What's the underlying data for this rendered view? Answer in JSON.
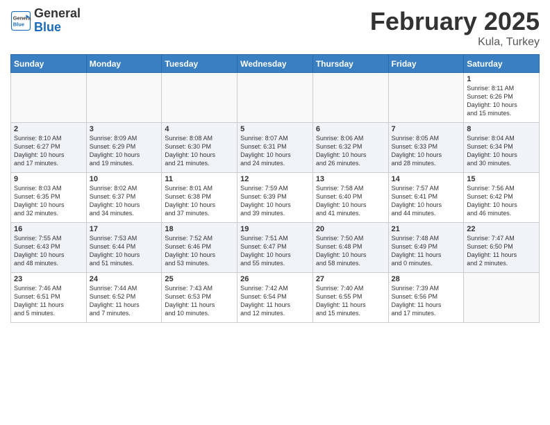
{
  "header": {
    "logo_line1": "General",
    "logo_line2": "Blue",
    "month_title": "February 2025",
    "location": "Kula, Turkey"
  },
  "weekdays": [
    "Sunday",
    "Monday",
    "Tuesday",
    "Wednesday",
    "Thursday",
    "Friday",
    "Saturday"
  ],
  "weeks": [
    [
      {
        "day": "",
        "info": ""
      },
      {
        "day": "",
        "info": ""
      },
      {
        "day": "",
        "info": ""
      },
      {
        "day": "",
        "info": ""
      },
      {
        "day": "",
        "info": ""
      },
      {
        "day": "",
        "info": ""
      },
      {
        "day": "1",
        "info": "Sunrise: 8:11 AM\nSunset: 6:26 PM\nDaylight: 10 hours\nand 15 minutes."
      }
    ],
    [
      {
        "day": "2",
        "info": "Sunrise: 8:10 AM\nSunset: 6:27 PM\nDaylight: 10 hours\nand 17 minutes."
      },
      {
        "day": "3",
        "info": "Sunrise: 8:09 AM\nSunset: 6:29 PM\nDaylight: 10 hours\nand 19 minutes."
      },
      {
        "day": "4",
        "info": "Sunrise: 8:08 AM\nSunset: 6:30 PM\nDaylight: 10 hours\nand 21 minutes."
      },
      {
        "day": "5",
        "info": "Sunrise: 8:07 AM\nSunset: 6:31 PM\nDaylight: 10 hours\nand 24 minutes."
      },
      {
        "day": "6",
        "info": "Sunrise: 8:06 AM\nSunset: 6:32 PM\nDaylight: 10 hours\nand 26 minutes."
      },
      {
        "day": "7",
        "info": "Sunrise: 8:05 AM\nSunset: 6:33 PM\nDaylight: 10 hours\nand 28 minutes."
      },
      {
        "day": "8",
        "info": "Sunrise: 8:04 AM\nSunset: 6:34 PM\nDaylight: 10 hours\nand 30 minutes."
      }
    ],
    [
      {
        "day": "9",
        "info": "Sunrise: 8:03 AM\nSunset: 6:35 PM\nDaylight: 10 hours\nand 32 minutes."
      },
      {
        "day": "10",
        "info": "Sunrise: 8:02 AM\nSunset: 6:37 PM\nDaylight: 10 hours\nand 34 minutes."
      },
      {
        "day": "11",
        "info": "Sunrise: 8:01 AM\nSunset: 6:38 PM\nDaylight: 10 hours\nand 37 minutes."
      },
      {
        "day": "12",
        "info": "Sunrise: 7:59 AM\nSunset: 6:39 PM\nDaylight: 10 hours\nand 39 minutes."
      },
      {
        "day": "13",
        "info": "Sunrise: 7:58 AM\nSunset: 6:40 PM\nDaylight: 10 hours\nand 41 minutes."
      },
      {
        "day": "14",
        "info": "Sunrise: 7:57 AM\nSunset: 6:41 PM\nDaylight: 10 hours\nand 44 minutes."
      },
      {
        "day": "15",
        "info": "Sunrise: 7:56 AM\nSunset: 6:42 PM\nDaylight: 10 hours\nand 46 minutes."
      }
    ],
    [
      {
        "day": "16",
        "info": "Sunrise: 7:55 AM\nSunset: 6:43 PM\nDaylight: 10 hours\nand 48 minutes."
      },
      {
        "day": "17",
        "info": "Sunrise: 7:53 AM\nSunset: 6:44 PM\nDaylight: 10 hours\nand 51 minutes."
      },
      {
        "day": "18",
        "info": "Sunrise: 7:52 AM\nSunset: 6:46 PM\nDaylight: 10 hours\nand 53 minutes."
      },
      {
        "day": "19",
        "info": "Sunrise: 7:51 AM\nSunset: 6:47 PM\nDaylight: 10 hours\nand 55 minutes."
      },
      {
        "day": "20",
        "info": "Sunrise: 7:50 AM\nSunset: 6:48 PM\nDaylight: 10 hours\nand 58 minutes."
      },
      {
        "day": "21",
        "info": "Sunrise: 7:48 AM\nSunset: 6:49 PM\nDaylight: 11 hours\nand 0 minutes."
      },
      {
        "day": "22",
        "info": "Sunrise: 7:47 AM\nSunset: 6:50 PM\nDaylight: 11 hours\nand 2 minutes."
      }
    ],
    [
      {
        "day": "23",
        "info": "Sunrise: 7:46 AM\nSunset: 6:51 PM\nDaylight: 11 hours\nand 5 minutes."
      },
      {
        "day": "24",
        "info": "Sunrise: 7:44 AM\nSunset: 6:52 PM\nDaylight: 11 hours\nand 7 minutes."
      },
      {
        "day": "25",
        "info": "Sunrise: 7:43 AM\nSunset: 6:53 PM\nDaylight: 11 hours\nand 10 minutes."
      },
      {
        "day": "26",
        "info": "Sunrise: 7:42 AM\nSunset: 6:54 PM\nDaylight: 11 hours\nand 12 minutes."
      },
      {
        "day": "27",
        "info": "Sunrise: 7:40 AM\nSunset: 6:55 PM\nDaylight: 11 hours\nand 15 minutes."
      },
      {
        "day": "28",
        "info": "Sunrise: 7:39 AM\nSunset: 6:56 PM\nDaylight: 11 hours\nand 17 minutes."
      },
      {
        "day": "",
        "info": ""
      }
    ]
  ]
}
